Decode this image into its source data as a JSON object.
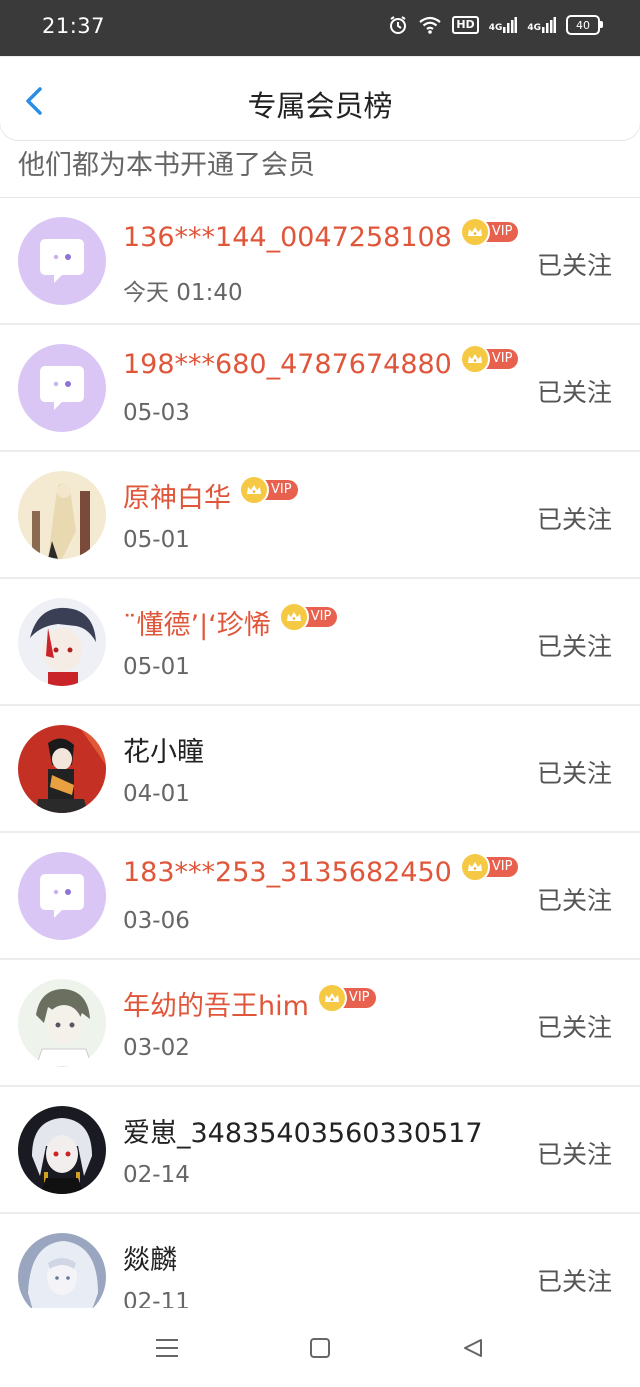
{
  "status_bar": {
    "time": "21:37",
    "hd_label": "HD",
    "sig1_label": "4G",
    "sig2_label": "4G",
    "battery": "40"
  },
  "header": {
    "title": "专属会员榜"
  },
  "subtitle": "他们都为本书开通了会员",
  "vip_label": "VIP",
  "members": [
    {
      "name": "136***144_0047258108",
      "vip": true,
      "date": "今天 01:40",
      "follow": "已关注",
      "avatar": "default-chat-avatar"
    },
    {
      "name": "198***680_4787674880",
      "vip": true,
      "date": "05-03",
      "follow": "已关注",
      "avatar": "default-chat-avatar"
    },
    {
      "name": "原神白华",
      "vip": true,
      "date": "05-01",
      "follow": "已关注",
      "avatar": "anime-avatar-light"
    },
    {
      "name": "¨懂德’|‘珍悕",
      "vip": true,
      "date": "05-01",
      "follow": "已关注",
      "avatar": "anime-avatar-red-dark"
    },
    {
      "name": "花小瞳",
      "vip": false,
      "date": "04-01",
      "follow": "已关注",
      "avatar": "anime-avatar-red"
    },
    {
      "name": "183***253_3135682450",
      "vip": true,
      "date": "03-06",
      "follow": "已关注",
      "avatar": "default-chat-avatar"
    },
    {
      "name": "年幼的吾王him",
      "vip": true,
      "date": "03-02",
      "follow": "已关注",
      "avatar": "anime-avatar-gray"
    },
    {
      "name": "爱崽_34835403560330517",
      "vip": false,
      "date": "02-14",
      "follow": "已关注",
      "avatar": "anime-avatar-white-hair"
    },
    {
      "name": "燚麟",
      "vip": false,
      "date": "02-11",
      "follow": "已关注",
      "avatar": "anime-avatar-silver"
    }
  ],
  "colors": {
    "vip_name": "#e0563a",
    "vip_tag": "#e8614e",
    "crown": "#f6c945",
    "accent": "#2a8ee8",
    "default_avatar": "#d9c6f5"
  }
}
